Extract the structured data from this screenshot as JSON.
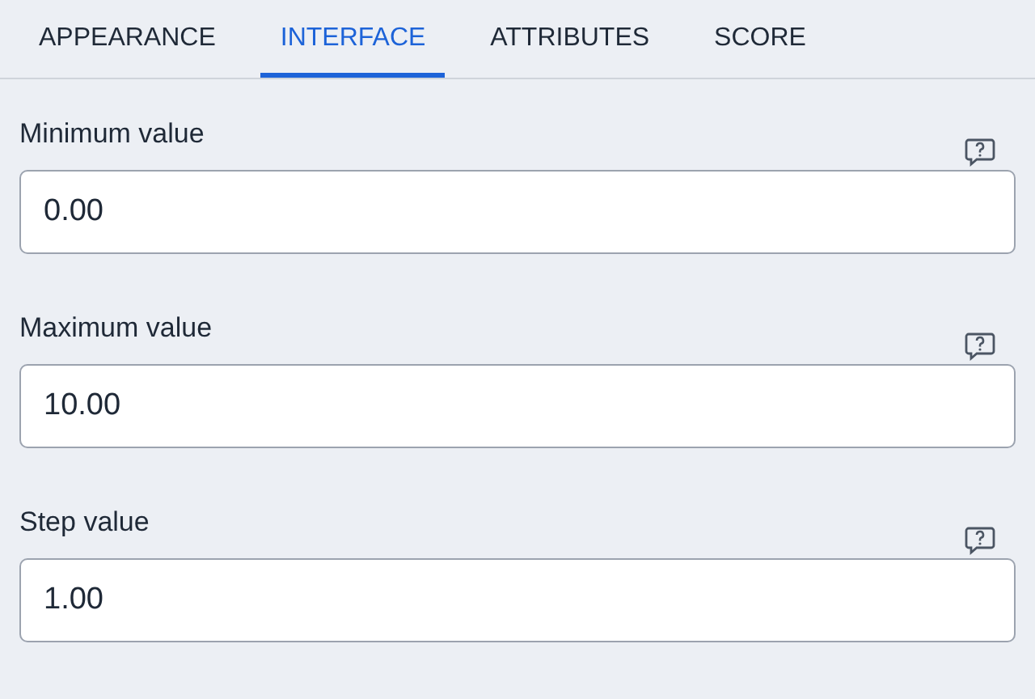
{
  "tabs": [
    {
      "label": "APPEARANCE",
      "selected": false
    },
    {
      "label": "INTERFACE",
      "selected": true
    },
    {
      "label": "ATTRIBUTES",
      "selected": false
    },
    {
      "label": "SCORE",
      "selected": false
    }
  ],
  "fields": [
    {
      "label": "Minimum value",
      "value": "0.00"
    },
    {
      "label": "Maximum value",
      "value": "10.00"
    },
    {
      "label": "Step value",
      "value": "1.00"
    }
  ]
}
